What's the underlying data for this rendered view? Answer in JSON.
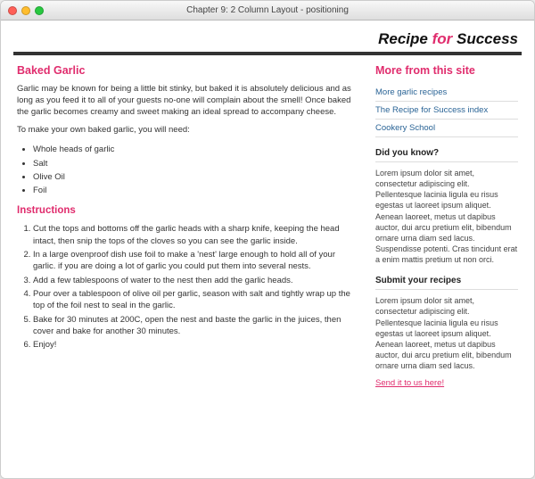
{
  "window": {
    "title": "Chapter 9: 2 Column Layout - positioning"
  },
  "site": {
    "title_pre": "Recipe ",
    "title_accent": "for",
    "title_post": " Success"
  },
  "main": {
    "heading": "Baked Garlic",
    "intro_p1": "Garlic may be known for being a little bit stinky, but baked it is absolutely delicious and as long as you feed it to all of your guests no-one will complain about the smell! Once baked the garlic becomes creamy and sweet making an ideal spread to accompany cheese.",
    "intro_p2": "To make your own baked garlic, you will need:",
    "ingredients": [
      "Whole heads of garlic",
      "Salt",
      "Olive Oil",
      "Foil"
    ],
    "instructions_heading": "Instructions",
    "steps": [
      "Cut the tops and bottoms off the garlic heads with a sharp knife, keeping the head intact, then snip the tops of the cloves so you can see the garlic inside.",
      "In a large ovenproof dish use foil to make a 'nest' large enough to hold all of your garlic. if you are doing a lot of garlic you could put them into several nests.",
      "Add a few tablespoons of water to the nest then add the garlic heads.",
      "Pour over a tablespoon of olive oil per garlic, season with salt and tightly wrap up the top of the foil nest to seal in the garlic.",
      "Bake for 30 minutes at 200C, open the nest and baste the garlic in the juices, then cover and bake for another 30 minutes.",
      "Enjoy!"
    ]
  },
  "sidebar": {
    "heading": "More from this site",
    "links": [
      "More garlic recipes",
      "The Recipe for Success index",
      "Cookery School"
    ],
    "dyk_heading": "Did you know?",
    "dyk_body": "Lorem ipsum dolor sit amet, consectetur adipiscing elit. Pellentesque lacinia ligula eu risus egestas ut laoreet ipsum aliquet. Aenean laoreet, metus ut dapibus auctor, dui arcu pretium elit, bibendum ornare urna diam sed lacus. Suspendisse potenti. Cras tincidunt erat a enim mattis pretium ut non orci.",
    "submit_heading": "Submit your recipes",
    "submit_body": "Lorem ipsum dolor sit amet, consectetur adipiscing elit. Pellentesque lacinia ligula eu risus egestas ut laoreet ipsum aliquet. Aenean laoreet, metus ut dapibus auctor, dui arcu pretium elit, bibendum ornare urna diam sed lacus.",
    "send_link": "Send it to us here!"
  }
}
